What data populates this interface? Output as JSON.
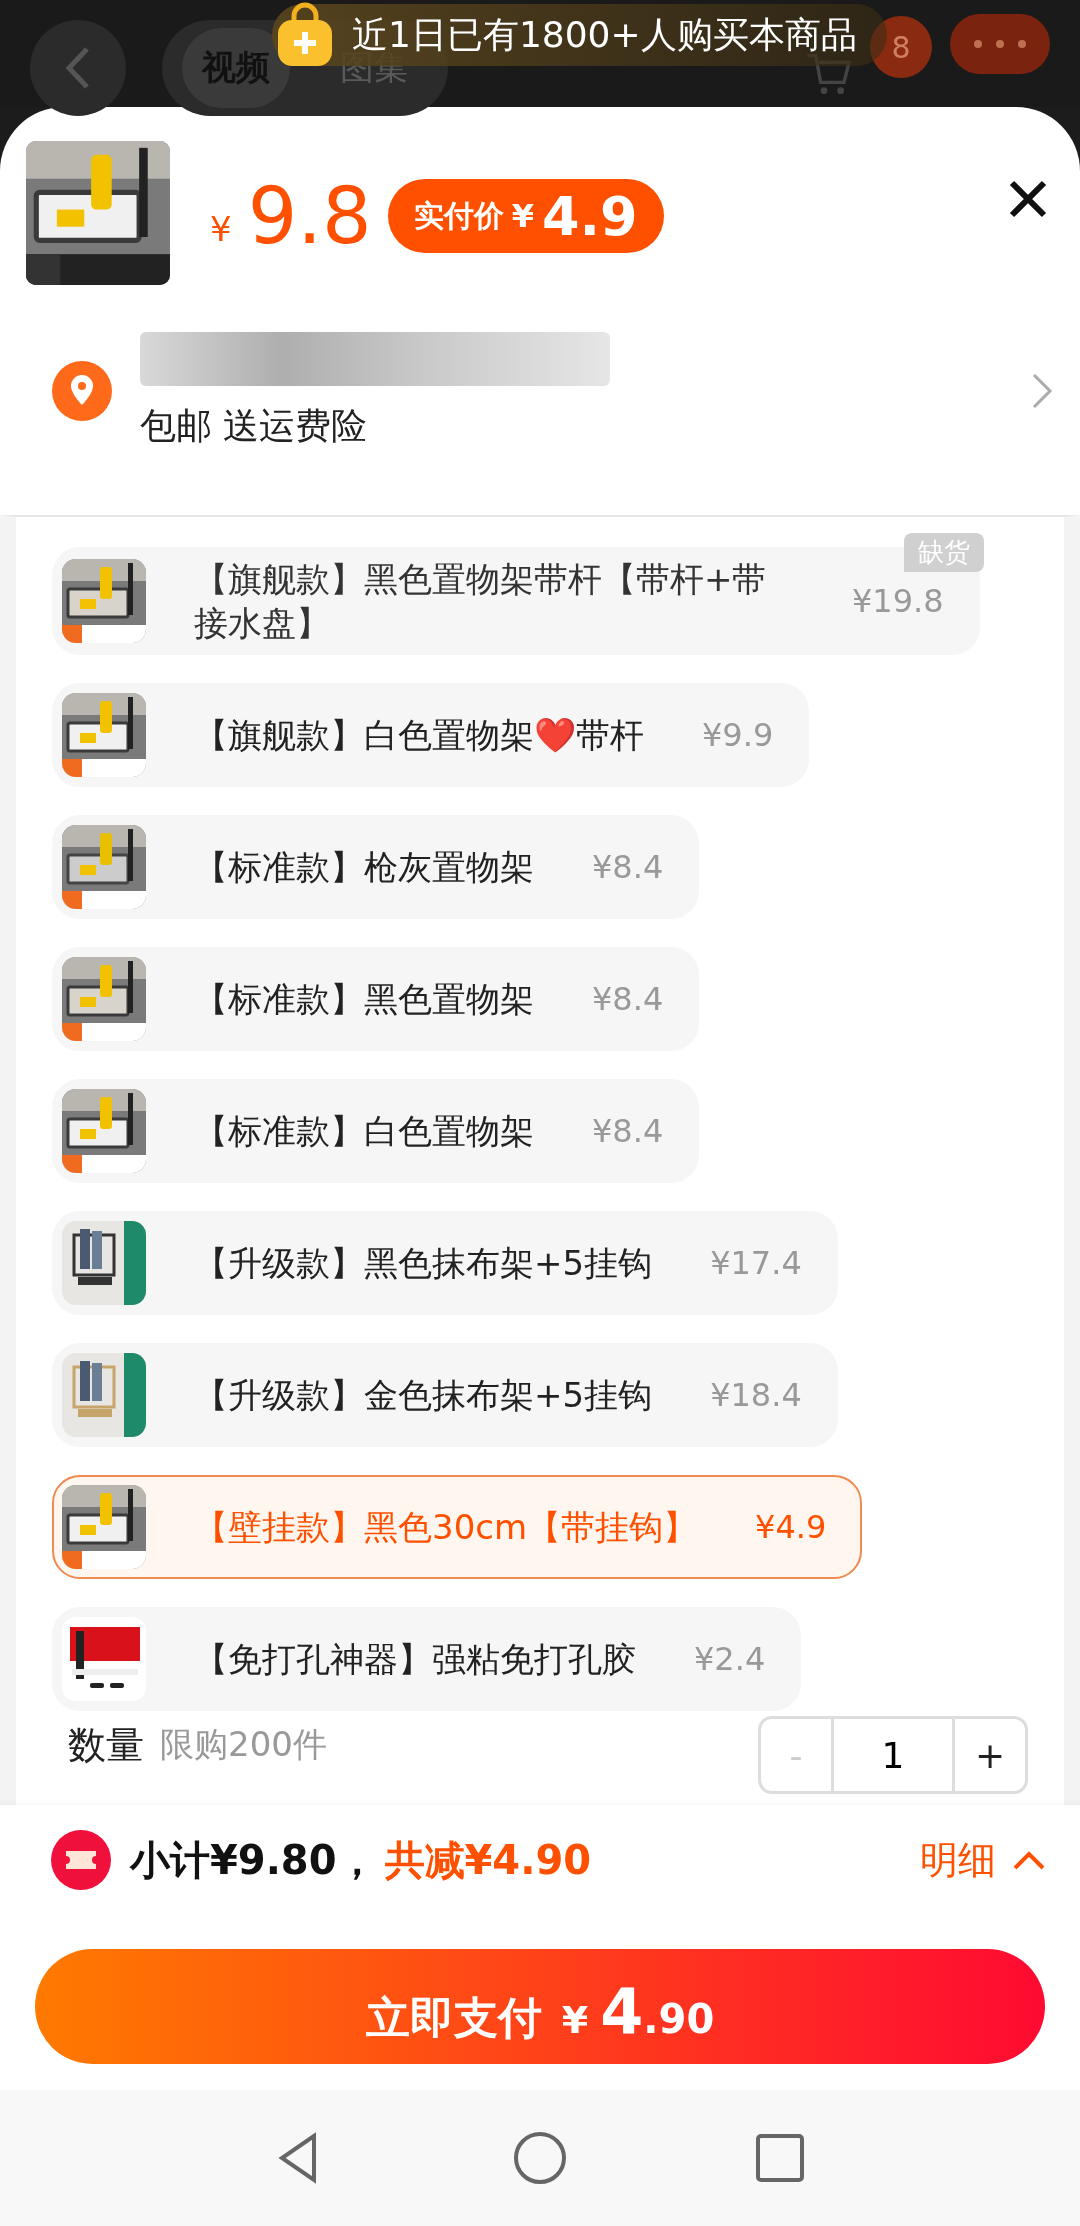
{
  "header": {
    "tabs": [
      {
        "label": "视频",
        "selected": true
      },
      {
        "label": "图集",
        "selected": false
      }
    ],
    "banner": "近1日已有1800+人购买本商品",
    "cart_badge": "8"
  },
  "sku_sheet": {
    "price_symbol": "¥",
    "price": "9.8",
    "actual_price_label": "实付价",
    "actual_price_symbol": "¥",
    "actual_price": "4.9",
    "address": {
      "shipping": "包邮 送运费险"
    },
    "options": [
      {
        "name": "【旗舰款】黑色置物架带杆【带杆+带接水盘】",
        "price": "¥19.8",
        "selected": false,
        "out_of_stock": true,
        "stock_badge": "缺货"
      },
      {
        "name": "【旗舰款】白色置物架❤️带杆",
        "price": "¥9.9",
        "selected": false,
        "out_of_stock": false
      },
      {
        "name": "【标准款】枪灰置物架",
        "price": "¥8.4",
        "selected": false,
        "out_of_stock": false
      },
      {
        "name": "【标准款】黑色置物架",
        "price": "¥8.4",
        "selected": false,
        "out_of_stock": false
      },
      {
        "name": "【标准款】白色置物架",
        "price": "¥8.4",
        "selected": false,
        "out_of_stock": false
      },
      {
        "name": "【升级款】黑色抹布架+5挂钩",
        "price": "¥17.4",
        "selected": false,
        "out_of_stock": false
      },
      {
        "name": "【升级款】金色抹布架+5挂钩",
        "price": "¥18.4",
        "selected": false,
        "out_of_stock": false
      },
      {
        "name": "【壁挂款】黑色30cm【带挂钩】",
        "price": "¥4.9",
        "selected": true,
        "out_of_stock": false
      },
      {
        "name": "【免打孔神器】强粘免打孔胶",
        "price": "¥2.4",
        "selected": false,
        "out_of_stock": false
      }
    ],
    "quantity": {
      "label": "数量",
      "limit": "限购200件",
      "value": "1",
      "minus": "-",
      "plus": "+",
      "minus_disabled": true
    },
    "summary": {
      "subtotal": "小计¥9.80，",
      "discount": "共减¥4.90",
      "detail": "明细"
    },
    "pay_button": {
      "label": "立即支付",
      "symbol": "¥",
      "integer": "4",
      "decimal": ".90"
    }
  }
}
